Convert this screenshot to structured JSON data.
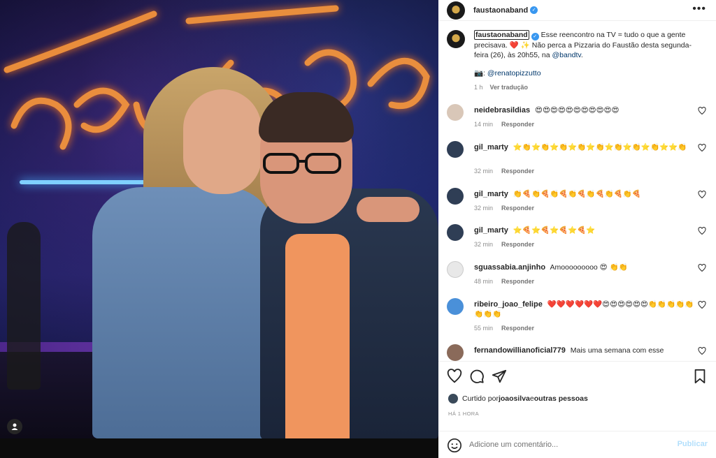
{
  "post": {
    "author": "faustaonaband",
    "more_icon": "more-horizontal-icon"
  },
  "caption": {
    "author": "faustaonaband",
    "line1": "Esse reencontro na TV = tudo o que a gente precisava. ❤️ ✨ Não perca a Pizzaria do Faustão desta segunda-feira (26), às 20h55, na ",
    "mention": "@bandtv",
    "line1_end": ".",
    "photo_prefix": "📷: ",
    "photo_credit": "@renatopizzutto",
    "time": "1 h",
    "translate": "Ver tradução"
  },
  "comments": [
    {
      "user": "neidebrasildias",
      "text": "😍😍😍😍😍😍😍😍😍😍😍",
      "time": "14 min",
      "reply": "Responder",
      "avatar_color": "#d9c7b8"
    },
    {
      "user": "gil_marty",
      "text": "⭐👏⭐👏⭐👏⭐👏⭐👏⭐👏⭐👏⭐👏⭐⭐👏",
      "time": "32 min",
      "reply": "Responder",
      "avatar_color": "#2f3e55"
    },
    {
      "user": "gil_marty",
      "text": "👏🍕👏🍕👏🍕👏🍕👏🍕👏🍕👏🍕",
      "time": "32 min",
      "reply": "Responder",
      "avatar_color": "#2f3e55"
    },
    {
      "user": "gil_marty",
      "text": "⭐🍕⭐🍕⭐🍕⭐🍕⭐",
      "time": "32 min",
      "reply": "Responder",
      "avatar_color": "#2f3e55"
    },
    {
      "user": "sguassabia.anjinho",
      "text": "Amooooooooo 😍 👏👏",
      "time": "48 min",
      "reply": "Responder",
      "avatar_color": "#e8e8e8"
    },
    {
      "user": "ribeiro_joao_felipe",
      "text": "❤️❤️❤️❤️❤️❤️😍😍😍😍😍😍👏👏👏👏👏👏👏👏",
      "time": "55 min",
      "reply": "Responder",
      "avatar_color": "#4a90d9"
    },
    {
      "user": "fernandowillianoficial779",
      "text": "Mais uma semana com esse",
      "time": "",
      "reply": "",
      "avatar_color": "#8a6a5a"
    }
  ],
  "actions": {
    "liked_prefix": "Curtido por ",
    "liked_user": "joaosilva",
    "liked_suffix": " e ",
    "liked_others": "outras pessoas",
    "time": "HÁ 1 HORA"
  },
  "add_comment": {
    "placeholder": "Adicione um comentário...",
    "post": "Publicar"
  }
}
